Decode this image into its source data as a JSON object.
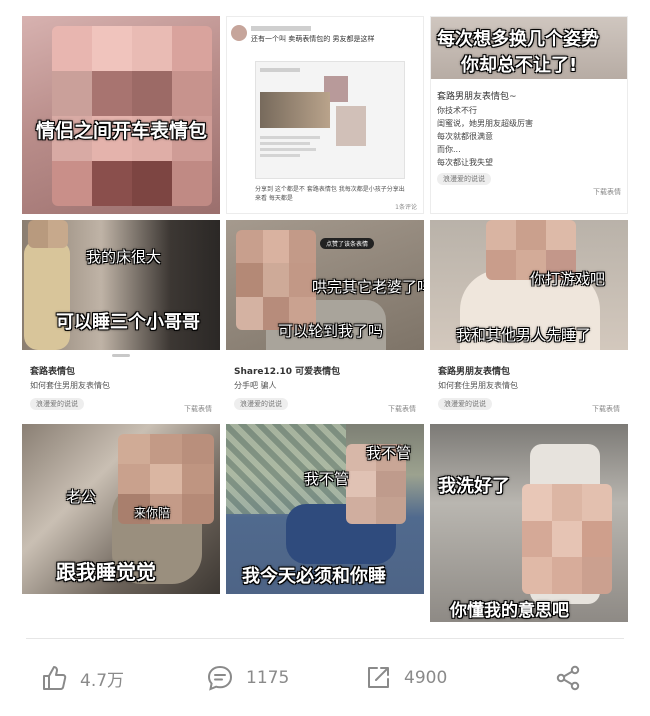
{
  "tiles": [
    {
      "caption": "情侣之间开车表情包"
    },
    {
      "post_text": "还有一个叫 卖萌表情包的 男友都是这样",
      "reply_text": "分享到 这个都是不 套路表情包 我每次都是小孩子分享出来看 每天都是",
      "reply_count": "1条评论"
    },
    {
      "banner_line1": "每次想多换几个姿势",
      "banner_line2": "你却总不让了!",
      "list_title": "套路男朋友表情包~",
      "list_items": [
        "你技术不行",
        "闺蜜说，她男朋友超级厉害",
        "每次就都很满意",
        "而你...",
        "每次都让我失望"
      ],
      "footer_left": "浪漫爱的说说",
      "footer_right": "下载表情"
    },
    {
      "caption1": "我的床很大",
      "caption2": "可以睡三个小哥哥",
      "title": "套路表情包",
      "subtitle": "如何套住男朋友表情包",
      "chip": "浪漫爱的说说",
      "right": "下载表情"
    },
    {
      "caption1": "哄完其它老婆了吗",
      "caption2": "可以轮到我了吗",
      "badge": "点赞了该条表情",
      "title": "Share12.10 可爱表情包",
      "subtitle": "分手吧 骗人",
      "chip": "浪漫爱的说说",
      "right": "下载表情"
    },
    {
      "caption1": "你打游戏吧",
      "caption2": "我和其他男人先睡了",
      "title": "套路男朋友表情包",
      "subtitle": "如何套住男朋友表情包",
      "chip": "浪漫爱的说说",
      "right": "下载表情"
    },
    {
      "caption1": "老公",
      "caption2": "来你陪",
      "caption3": "跟我睡觉觉"
    },
    {
      "caption1": "我不管",
      "caption2": "我不管",
      "caption3": "我今天必须和你睡"
    },
    {
      "caption1": "我洗好了",
      "caption2": "你懂我的意思吧"
    }
  ],
  "actions": {
    "like_count": "4.7万",
    "comment_count": "1175",
    "share_count": "4900"
  },
  "icons": {
    "like": "thumbs-up-icon",
    "comment": "comment-bubble-icon",
    "share": "share-arrow-icon",
    "more": "share-nodes-icon"
  },
  "colors": {
    "icon_gray": "#8a8a8a",
    "caption_text": "#ffffff"
  }
}
